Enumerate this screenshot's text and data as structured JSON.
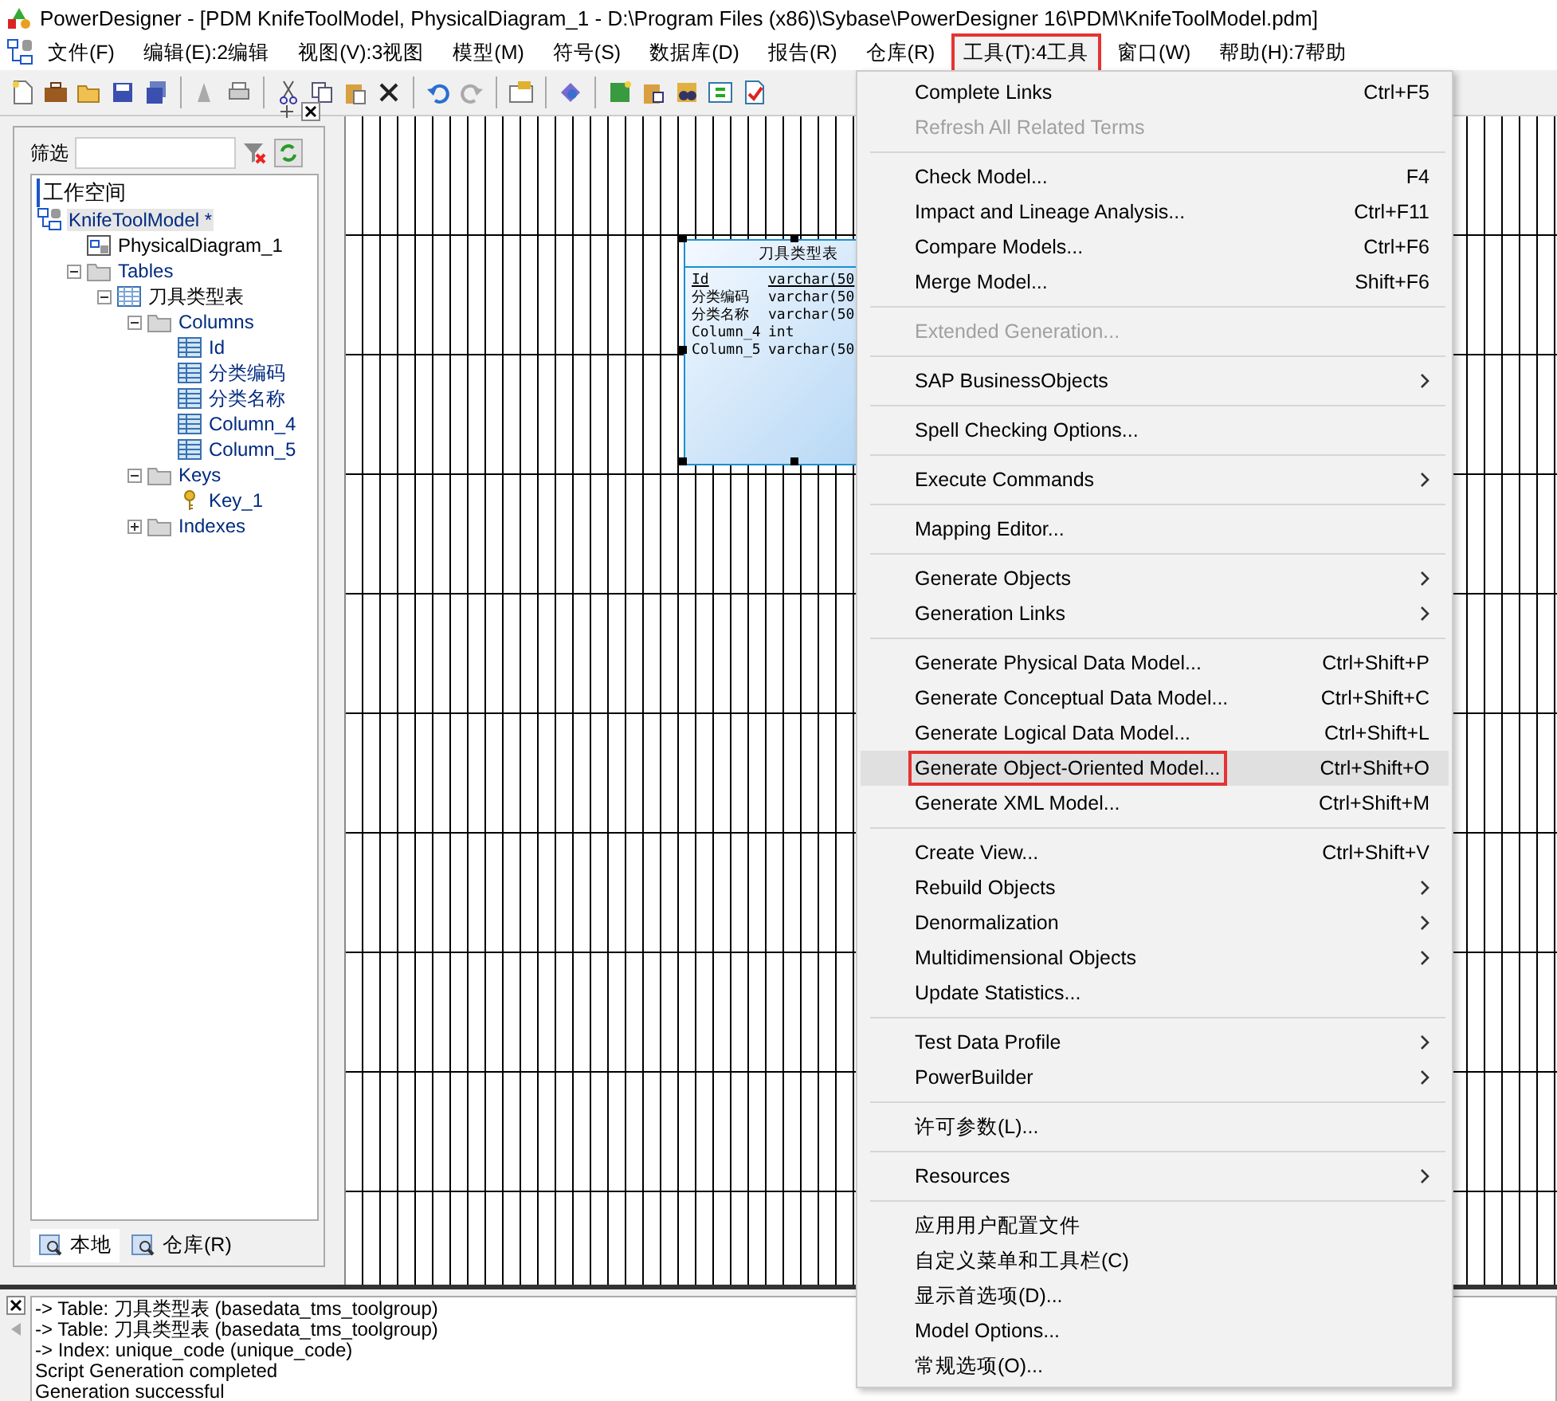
{
  "window": {
    "title": "PowerDesigner - [PDM KnifeToolModel, PhysicalDiagram_1 - D:\\Program Files (x86)\\Sybase\\PowerDesigner 16\\PDM\\KnifeToolModel.pdm]"
  },
  "menubar": [
    {
      "label": "文件(F)",
      "selected": false
    },
    {
      "label": "编辑(E):2编辑",
      "selected": false
    },
    {
      "label": "视图(V):3视图",
      "selected": false
    },
    {
      "label": "模型(M)",
      "selected": false
    },
    {
      "label": "符号(S)",
      "selected": false
    },
    {
      "label": "数据库(D)",
      "selected": false
    },
    {
      "label": "报告(R)",
      "selected": false
    },
    {
      "label": "仓库(R)",
      "selected": false
    },
    {
      "label": "工具(T):4工具",
      "selected": true
    },
    {
      "label": "窗口(W)",
      "selected": false
    },
    {
      "label": "帮助(H):7帮助",
      "selected": false
    }
  ],
  "browser": {
    "filter_label": "筛选",
    "workspace": "工作空间",
    "tree": [
      {
        "label": "KnifeToolModel *",
        "kind": "model",
        "selected": true,
        "children": [
          {
            "label": "PhysicalDiagram_1",
            "kind": "diagram",
            "selected": false
          },
          {
            "label": "Tables",
            "kind": "folder",
            "expanded": true,
            "selected": false,
            "children": [
              {
                "label": "刀具类型表",
                "kind": "table",
                "expanded": true,
                "selected": false,
                "children": [
                  {
                    "label": "Columns",
                    "kind": "folder",
                    "expanded": true,
                    "selected": false,
                    "children": [
                      {
                        "label": "Id",
                        "kind": "column",
                        "selected": false
                      },
                      {
                        "label": "分类编码",
                        "kind": "column",
                        "selected": false
                      },
                      {
                        "label": "分类名称",
                        "kind": "column",
                        "selected": false
                      },
                      {
                        "label": "Column_4",
                        "kind": "column",
                        "selected": false
                      },
                      {
                        "label": "Column_5",
                        "kind": "column",
                        "selected": false
                      }
                    ]
                  },
                  {
                    "label": "Keys",
                    "kind": "folder",
                    "expanded": true,
                    "selected": false,
                    "children": [
                      {
                        "label": "Key_1",
                        "kind": "key",
                        "selected": false
                      }
                    ]
                  },
                  {
                    "label": "Indexes",
                    "kind": "folder",
                    "expanded": false,
                    "selected": false
                  }
                ]
              }
            ]
          }
        ]
      }
    ],
    "tabs": [
      {
        "label": "本地",
        "selected": true
      },
      {
        "label": "仓库(R)",
        "selected": false
      }
    ]
  },
  "diagram": {
    "table": {
      "title": "刀具类型表",
      "columns": [
        {
          "name": "Id",
          "type": "varchar(50",
          "primary": true
        },
        {
          "name": "分类编码",
          "type": "varchar(50",
          "primary": false
        },
        {
          "name": "分类名称",
          "type": "varchar(50",
          "primary": false
        },
        {
          "name": "Column_4",
          "type": "int",
          "primary": false
        },
        {
          "name": "Column_5",
          "type": "varchar(50",
          "primary": false
        }
      ]
    }
  },
  "tools_menu": [
    [
      {
        "label": "Complete Links",
        "shortcut": "Ctrl+F5",
        "submenu": false,
        "disabled": false,
        "selected": false
      },
      {
        "label": "Refresh All Related Terms",
        "submenu": false,
        "disabled": true,
        "selected": false
      }
    ],
    [
      {
        "label": "Check Model...",
        "shortcut": "F4",
        "submenu": false,
        "disabled": false,
        "selected": false
      },
      {
        "label": "Impact and Lineage Analysis...",
        "shortcut": "Ctrl+F11",
        "submenu": false,
        "disabled": false,
        "selected": false
      },
      {
        "label": "Compare Models...",
        "shortcut": "Ctrl+F6",
        "submenu": false,
        "disabled": false,
        "selected": false
      },
      {
        "label": "Merge Model...",
        "shortcut": "Shift+F6",
        "submenu": false,
        "disabled": false,
        "selected": false
      }
    ],
    [
      {
        "label": "Extended Generation...",
        "submenu": false,
        "disabled": true,
        "selected": false
      }
    ],
    [
      {
        "label": "SAP BusinessObjects",
        "submenu": true,
        "disabled": false,
        "selected": false
      }
    ],
    [
      {
        "label": "Spell Checking Options...",
        "submenu": false,
        "disabled": false,
        "selected": false
      }
    ],
    [
      {
        "label": "Execute Commands",
        "submenu": true,
        "disabled": false,
        "selected": false
      }
    ],
    [
      {
        "label": "Mapping Editor...",
        "submenu": false,
        "disabled": false,
        "selected": false
      }
    ],
    [
      {
        "label": "Generate Objects",
        "submenu": true,
        "disabled": false,
        "selected": false
      },
      {
        "label": "Generation Links",
        "submenu": true,
        "disabled": false,
        "selected": false
      }
    ],
    [
      {
        "label": "Generate Physical Data Model...",
        "shortcut": "Ctrl+Shift+P",
        "submenu": false,
        "disabled": false,
        "selected": false
      },
      {
        "label": "Generate Conceptual Data Model...",
        "shortcut": "Ctrl+Shift+C",
        "submenu": false,
        "disabled": false,
        "selected": false
      },
      {
        "label": "Generate Logical Data Model...",
        "shortcut": "Ctrl+Shift+L",
        "submenu": false,
        "disabled": false,
        "selected": false
      },
      {
        "label": "Generate Object-Oriented Model...",
        "shortcut": "Ctrl+Shift+O",
        "submenu": false,
        "disabled": false,
        "selected": true
      },
      {
        "label": "Generate XML Model...",
        "shortcut": "Ctrl+Shift+M",
        "submenu": false,
        "disabled": false,
        "selected": false
      }
    ],
    [
      {
        "label": "Create View...",
        "shortcut": "Ctrl+Shift+V",
        "submenu": false,
        "disabled": false,
        "selected": false
      },
      {
        "label": "Rebuild Objects",
        "submenu": true,
        "disabled": false,
        "selected": false
      },
      {
        "label": "Denormalization",
        "submenu": true,
        "disabled": false,
        "selected": false
      },
      {
        "label": "Multidimensional Objects",
        "submenu": true,
        "disabled": false,
        "selected": false
      },
      {
        "label": "Update Statistics...",
        "submenu": false,
        "disabled": false,
        "selected": false
      }
    ],
    [
      {
        "label": "Test Data Profile",
        "submenu": true,
        "disabled": false,
        "selected": false
      },
      {
        "label": "PowerBuilder",
        "submenu": true,
        "disabled": false,
        "selected": false
      }
    ],
    [
      {
        "label": "许可参数(L)...",
        "submenu": false,
        "disabled": false,
        "selected": false
      }
    ],
    [
      {
        "label": "Resources",
        "submenu": true,
        "disabled": false,
        "selected": false
      }
    ],
    [
      {
        "label": "应用用户配置文件",
        "submenu": false,
        "disabled": false,
        "selected": false
      },
      {
        "label": "自定义菜单和工具栏(C)",
        "submenu": false,
        "disabled": false,
        "selected": false
      },
      {
        "label": "显示首选项(D)...",
        "submenu": false,
        "disabled": false,
        "selected": false
      },
      {
        "label": "Model Options...",
        "submenu": false,
        "disabled": false,
        "selected": false
      },
      {
        "label": "常规选项(O)...",
        "submenu": false,
        "disabled": false,
        "selected": false
      }
    ]
  ],
  "output": [
    "-> Table: 刀具类型表 (basedata_tms_toolgroup)",
    "-> Table: 刀具类型表 (basedata_tms_toolgroup)",
    "-> Index: unique_code (unique_code)",
    "Script Generation completed",
    "Generation successful"
  ]
}
